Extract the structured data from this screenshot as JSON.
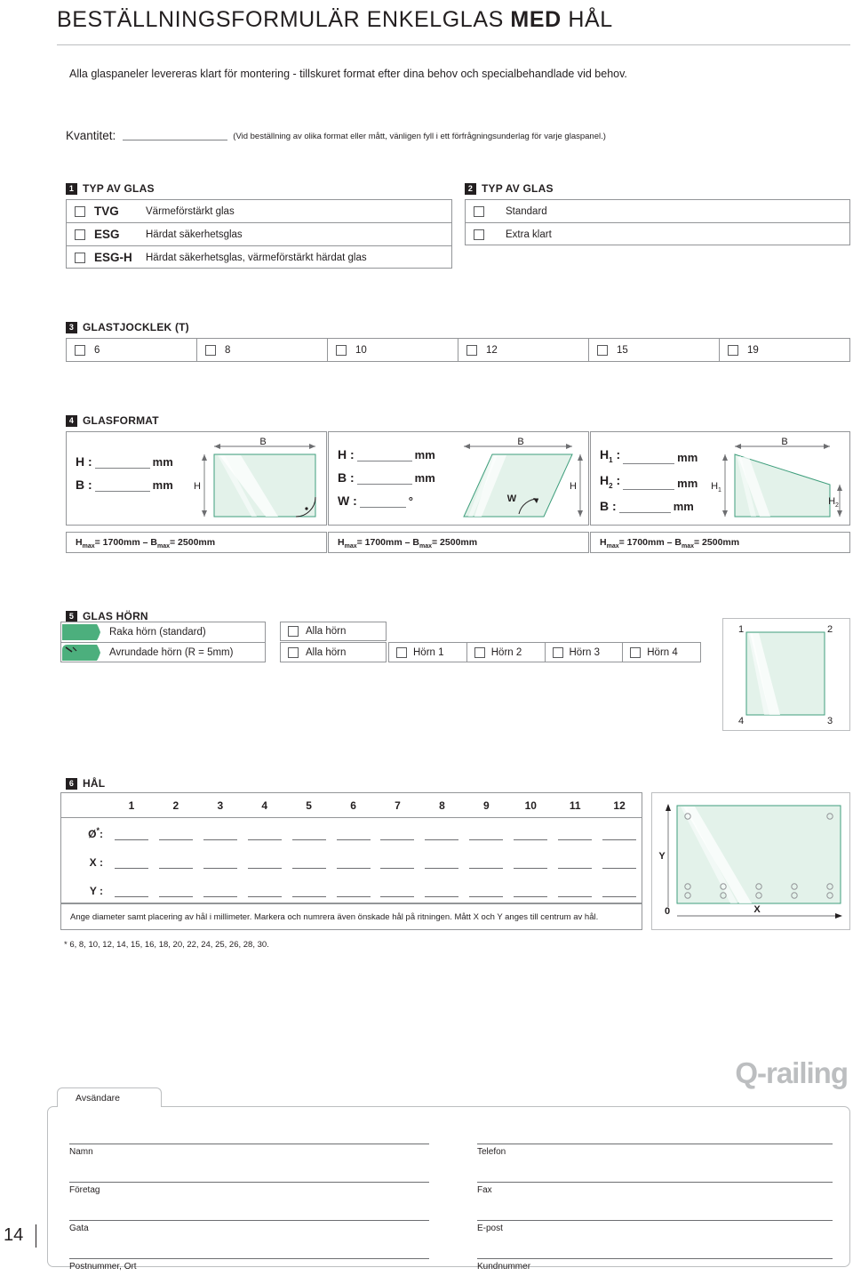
{
  "document": {
    "title_plain_1": "BESTÄLLNINGSFORMULÄR ENKELGLAS ",
    "title_bold": "MED",
    "title_plain_2": " HÅL",
    "intro": "Alla glaspaneler levereras klart för montering - tillskuret format efter dina behov och specialbehandlade vid behov.",
    "page_number": "14"
  },
  "quantity": {
    "label": "Kvantitet:",
    "value": "",
    "note": "(Vid beställning av olika format eller mått, vänligen fyll i ett förfrågningsunderlag för varje glaspanel.)"
  },
  "section1": {
    "number": "1",
    "heading": "TYP AV GLAS",
    "options": [
      {
        "code": "TVG",
        "desc": "Värmeförstärkt glas",
        "checked": false
      },
      {
        "code": "ESG",
        "desc": "Härdat säkerhetsglas",
        "checked": false
      },
      {
        "code": "ESG-H",
        "desc": "Härdat säkerhetsglas, värmeförstärkt härdat glas",
        "checked": false
      }
    ]
  },
  "section2": {
    "number": "2",
    "heading": "TYP AV GLAS",
    "options": [
      {
        "label": "Standard",
        "checked": false
      },
      {
        "label": "Extra klart",
        "checked": false
      }
    ]
  },
  "section3": {
    "number": "3",
    "heading": "GLASTJOCKLEK (T)",
    "options": [
      "6",
      "8",
      "10",
      "12",
      "15",
      "19"
    ]
  },
  "section4": {
    "number": "4",
    "heading": "GLASFORMAT",
    "panels": [
      {
        "shape": "rectangle",
        "fields": [
          {
            "label": "H :",
            "unit": "mm",
            "value": ""
          },
          {
            "label": "B :",
            "unit": "mm",
            "value": ""
          }
        ],
        "dim_labels": {
          "width": "B",
          "height": "H"
        },
        "max_note_h": "H",
        "max_note_h_sub": "max",
        "max_note_h_val": "= 1700mm",
        "max_note_sep": "–",
        "max_note_b": "B",
        "max_note_b_sub": "max",
        "max_note_b_val": "= 2500mm"
      },
      {
        "shape": "parallelogram",
        "fields": [
          {
            "label": "H :",
            "unit": "mm",
            "value": ""
          },
          {
            "label": "B :",
            "unit": "mm",
            "value": ""
          },
          {
            "label": "W :",
            "unit": "°",
            "value": ""
          }
        ],
        "dim_labels": {
          "width": "B",
          "height": "H",
          "angle": "W"
        },
        "max_note_h": "H",
        "max_note_h_sub": "max",
        "max_note_h_val": "= 1700mm",
        "max_note_sep": "–",
        "max_note_b": "B",
        "max_note_b_sub": "max",
        "max_note_b_val": "= 2500mm"
      },
      {
        "shape": "trapezoid",
        "fields": [
          {
            "label": "H",
            "sub": "1",
            "label_tail": " :",
            "unit": "mm",
            "value": ""
          },
          {
            "label": "H",
            "sub": "2",
            "label_tail": " :",
            "unit": "mm",
            "value": ""
          },
          {
            "label": "B",
            "sub": "",
            "label_tail": " :",
            "unit": "mm",
            "value": ""
          }
        ],
        "dim_labels": {
          "width": "B",
          "height1": "H",
          "height1_sub": "1",
          "height2": "H",
          "height2_sub": "2"
        },
        "max_note_h": "H",
        "max_note_h_sub": "max",
        "max_note_h_val": "= 1700mm",
        "max_note_sep": "–",
        "max_note_b": "B",
        "max_note_b_sub": "max",
        "max_note_b_val": "= 2500mm"
      }
    ]
  },
  "section5": {
    "number": "5",
    "heading": "GLAS HÖRN",
    "types": [
      {
        "label": "Raka hörn (standard)",
        "icon": "square-corner-icon"
      },
      {
        "label": "Avrundade hörn (R = 5mm)",
        "icon": "rounded-corner-icon"
      }
    ],
    "all_corners": [
      {
        "label": "Alla hörn",
        "checked": false
      },
      {
        "label": "Alla hörn",
        "checked": false
      }
    ],
    "individual_corners": [
      {
        "label": "Hörn 1",
        "checked": false
      },
      {
        "label": "Hörn 2",
        "checked": false
      },
      {
        "label": "Hörn 3",
        "checked": false
      },
      {
        "label": "Hörn 4",
        "checked": false
      }
    ],
    "diagram_corner_numbers": [
      "1",
      "2",
      "3",
      "4"
    ]
  },
  "section6": {
    "number": "6",
    "heading": "HÅL",
    "column_headers": [
      "1",
      "2",
      "3",
      "4",
      "5",
      "6",
      "7",
      "8",
      "9",
      "10",
      "11",
      "12"
    ],
    "rows": [
      {
        "label": "Ø",
        "sup": "*",
        "label_tail": ":",
        "values": [
          "",
          "",
          "",
          "",
          "",
          "",
          "",
          "",
          "",
          "",
          "",
          ""
        ]
      },
      {
        "label": "X",
        "sup": "",
        "label_tail": " :",
        "values": [
          "",
          "",
          "",
          "",
          "",
          "",
          "",
          "",
          "",
          "",
          "",
          ""
        ]
      },
      {
        "label": "Y",
        "sup": "",
        "label_tail": " :",
        "values": [
          "",
          "",
          "",
          "",
          "",
          "",
          "",
          "",
          "",
          "",
          "",
          ""
        ]
      }
    ],
    "note": "Ange diameter samt placering av hål i millimeter. Markera och numrera även önskade hål på ritningen. Mått X och Y anges till centrum av hål.",
    "star_note": "* 6, 8, 10, 12, 14, 15, 16, 18, 20, 22, 24, 25, 26, 28, 30.",
    "diagram_axis_x": "X",
    "diagram_axis_y": "Y",
    "diagram_origin": "0"
  },
  "footer": {
    "logo_q": "Q",
    "logo_rest": "-railing",
    "sender_tab": "Avsändare",
    "fields_left": [
      "Namn",
      "Företag",
      "Gata",
      "Postnummer, Ort"
    ],
    "fields_right": [
      "Telefon",
      "Fax",
      "E-post",
      "Kundnummer"
    ]
  },
  "colors": {
    "glass_fill": "#e3f2ea",
    "glass_stroke": "#3f9e7c",
    "corner_icon_green": "#4caf7d",
    "rule_gray": "#bcbec0",
    "box_border": "#939598",
    "logo_gray": "#bcbec0"
  }
}
